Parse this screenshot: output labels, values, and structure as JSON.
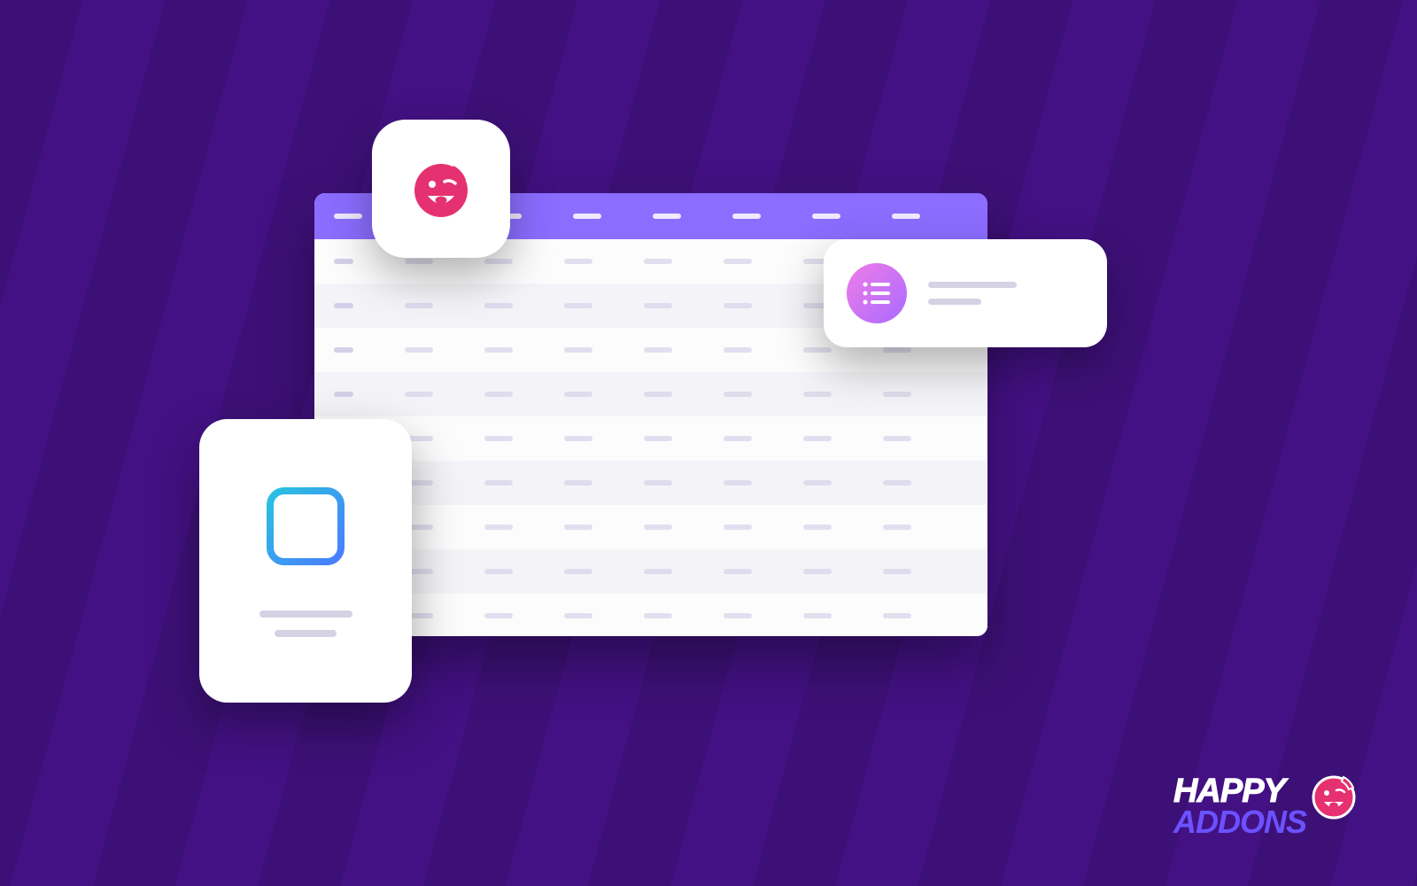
{
  "brand": {
    "line1": "HAPPY",
    "line2": "ADDONS"
  },
  "colors": {
    "background": "#3d1077",
    "stripe_alt": "#431183",
    "table_header": "#8b6dff",
    "placeholder_light": "#d5d2e4",
    "accent_pink": "#e53170",
    "accent_purple": "#a96bff",
    "accent_blue_start": "#29c2e0",
    "accent_blue_end": "#4a7cff"
  },
  "table": {
    "columns": 8,
    "rows": 9
  },
  "cards": {
    "face": {
      "icon": "happy-face-icon"
    },
    "list": {
      "icon": "bullet-list-icon",
      "lines": 2
    },
    "grid": {
      "icon": "table-grid-icon",
      "lines": 2
    }
  }
}
